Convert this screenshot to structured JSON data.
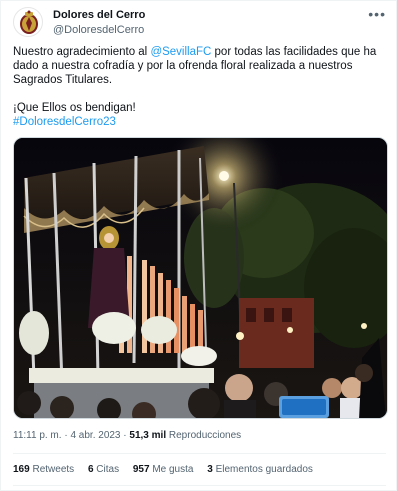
{
  "author": {
    "display_name": "Dolores del Cerro",
    "handle": "@DoloresdelCerro",
    "avatar_icon": "crest-icon"
  },
  "more_icon": "more-horizontal-icon",
  "more_glyph": "•••",
  "tweet": {
    "line1_pre": "Nuestro agradecimiento al ",
    "mention": "@SevillaFC",
    "line1_post": " por todas las facilidades que ha dado a nuestra cofradía y por la ofrenda floral realizada a nuestros Sagrados Titulares.",
    "line2": "¡Que Ellos os bendigan!",
    "hashtag": "#DoloresdelCerro23"
  },
  "media": {
    "description_icon": "procession-photo"
  },
  "meta": {
    "time": "11:11 p. m.",
    "separator": "·",
    "date": "4 abr. 2023",
    "views_count": "51,3 mil",
    "views_label": "Reproducciones"
  },
  "stats": {
    "retweets_count": "169",
    "retweets_label": "Retweets",
    "quotes_count": "6",
    "quotes_label": "Citas",
    "likes_count": "957",
    "likes_label": "Me gusta",
    "bookmarks_count": "3",
    "bookmarks_label": "Elementos guardados"
  },
  "colors": {
    "link": "#1d9bf0",
    "secondary_text": "#536471",
    "primary_text": "#0f1419"
  }
}
